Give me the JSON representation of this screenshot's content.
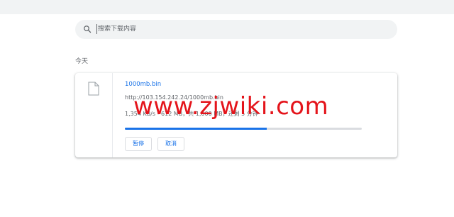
{
  "search": {
    "placeholder": "搜索下载内容",
    "value": ""
  },
  "downloads": {
    "date_heading": "今天",
    "items": [
      {
        "file_name": "1000mb.bin",
        "url": "http://103.154.242.24/1000mb.bin",
        "status": "1,354 KB/s - 612 MB，共 1,000 MB，还剩 5 分钟",
        "progress": 0.6,
        "pause_label": "暂停",
        "cancel_label": "取消"
      }
    ]
  },
  "watermark": {
    "text": "www.zjwiki.com"
  },
  "colors": {
    "accent": "#1a73e8",
    "watermark": "#e4141b",
    "muted_text": "#5f6368",
    "surface": "#f1f3f4"
  }
}
